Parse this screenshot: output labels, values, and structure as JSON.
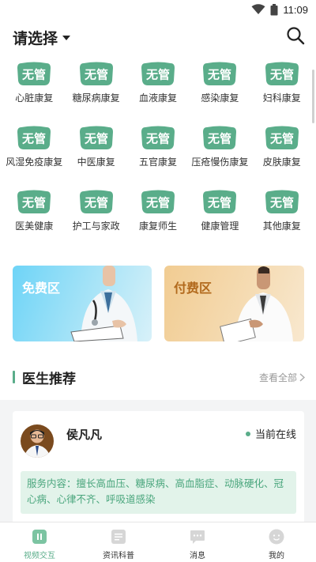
{
  "status_bar": {
    "time": "11:09"
  },
  "header": {
    "title": "请选择"
  },
  "categories": [
    {
      "badge": "无管",
      "label": "心脏康复"
    },
    {
      "badge": "无管",
      "label": "糖尿病康复"
    },
    {
      "badge": "无管",
      "label": "血液康复"
    },
    {
      "badge": "无管",
      "label": "感染康复"
    },
    {
      "badge": "无管",
      "label": "妇科康复"
    },
    {
      "badge": "无管",
      "label": "风湿免疫康复"
    },
    {
      "badge": "无管",
      "label": "中医康复"
    },
    {
      "badge": "无管",
      "label": "五官康复"
    },
    {
      "badge": "无管",
      "label": "压疮慢伤康复"
    },
    {
      "badge": "无管",
      "label": "皮肤康复"
    },
    {
      "badge": "无管",
      "label": "医美健康"
    },
    {
      "badge": "无管",
      "label": "护工与家政"
    },
    {
      "badge": "无管",
      "label": "康复师生"
    },
    {
      "badge": "无管",
      "label": "健康管理"
    },
    {
      "badge": "无管",
      "label": "其他康复"
    }
  ],
  "zones": {
    "free_label": "免费区",
    "paid_label": "付费区"
  },
  "doctors_section": {
    "title": "医生推荐",
    "view_all": "查看全部"
  },
  "doctor": {
    "name": "侯凡凡",
    "status": "当前在线",
    "service": "服务内容：擅长高血压、糖尿病、高血脂症、动脉硬化、冠心病、心律不齐、呼吸道感染"
  },
  "bottom_nav": [
    {
      "label": "视频交互",
      "icon": "video-icon",
      "active": true
    },
    {
      "label": "资讯科普",
      "icon": "news-icon",
      "active": false
    },
    {
      "label": "消息",
      "icon": "message-icon",
      "active": false
    },
    {
      "label": "我的",
      "icon": "profile-icon",
      "active": false
    }
  ],
  "colors": {
    "brand": "#5aad8a",
    "badge": "#5aad8a",
    "paid_text": "#b26a1d"
  }
}
